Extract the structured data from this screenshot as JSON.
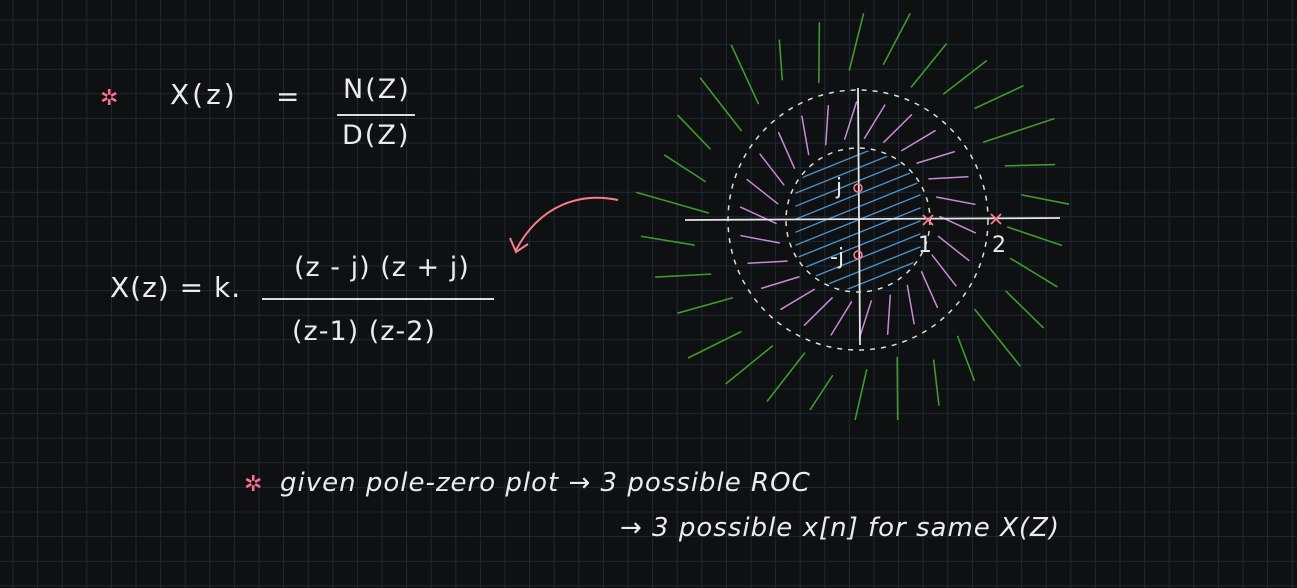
{
  "equation1": {
    "lhs": "X(z)",
    "equals": "=",
    "numerator": "N(Z)",
    "denominator": "D(Z)"
  },
  "equation2": {
    "lhs": "X(z) = k.",
    "numerator": "(z - j) (z + j)",
    "denominator": "(z-1) (z-2)"
  },
  "pole_zero_plot": {
    "zero_upper_label": "j",
    "zero_lower_label": "-j",
    "pole1_label": "1",
    "pole2_label": "2"
  },
  "notes": {
    "line1": "given pole-zero plot → 3 possible ROC",
    "line2": "→ 3 possible x[n] for same X(Z)"
  },
  "colors": {
    "background": "#0f1012",
    "grid": "#1c2a33",
    "ink": "#e9e9e9",
    "star": "#ff6f8f",
    "green": "#3f9a2c",
    "blue": "#4a90c8",
    "pink": "#c98ad8",
    "red_mark": "#ff7b8a"
  },
  "icons": {
    "star": "star-icon",
    "arrow": "curved-arrow-icon"
  }
}
